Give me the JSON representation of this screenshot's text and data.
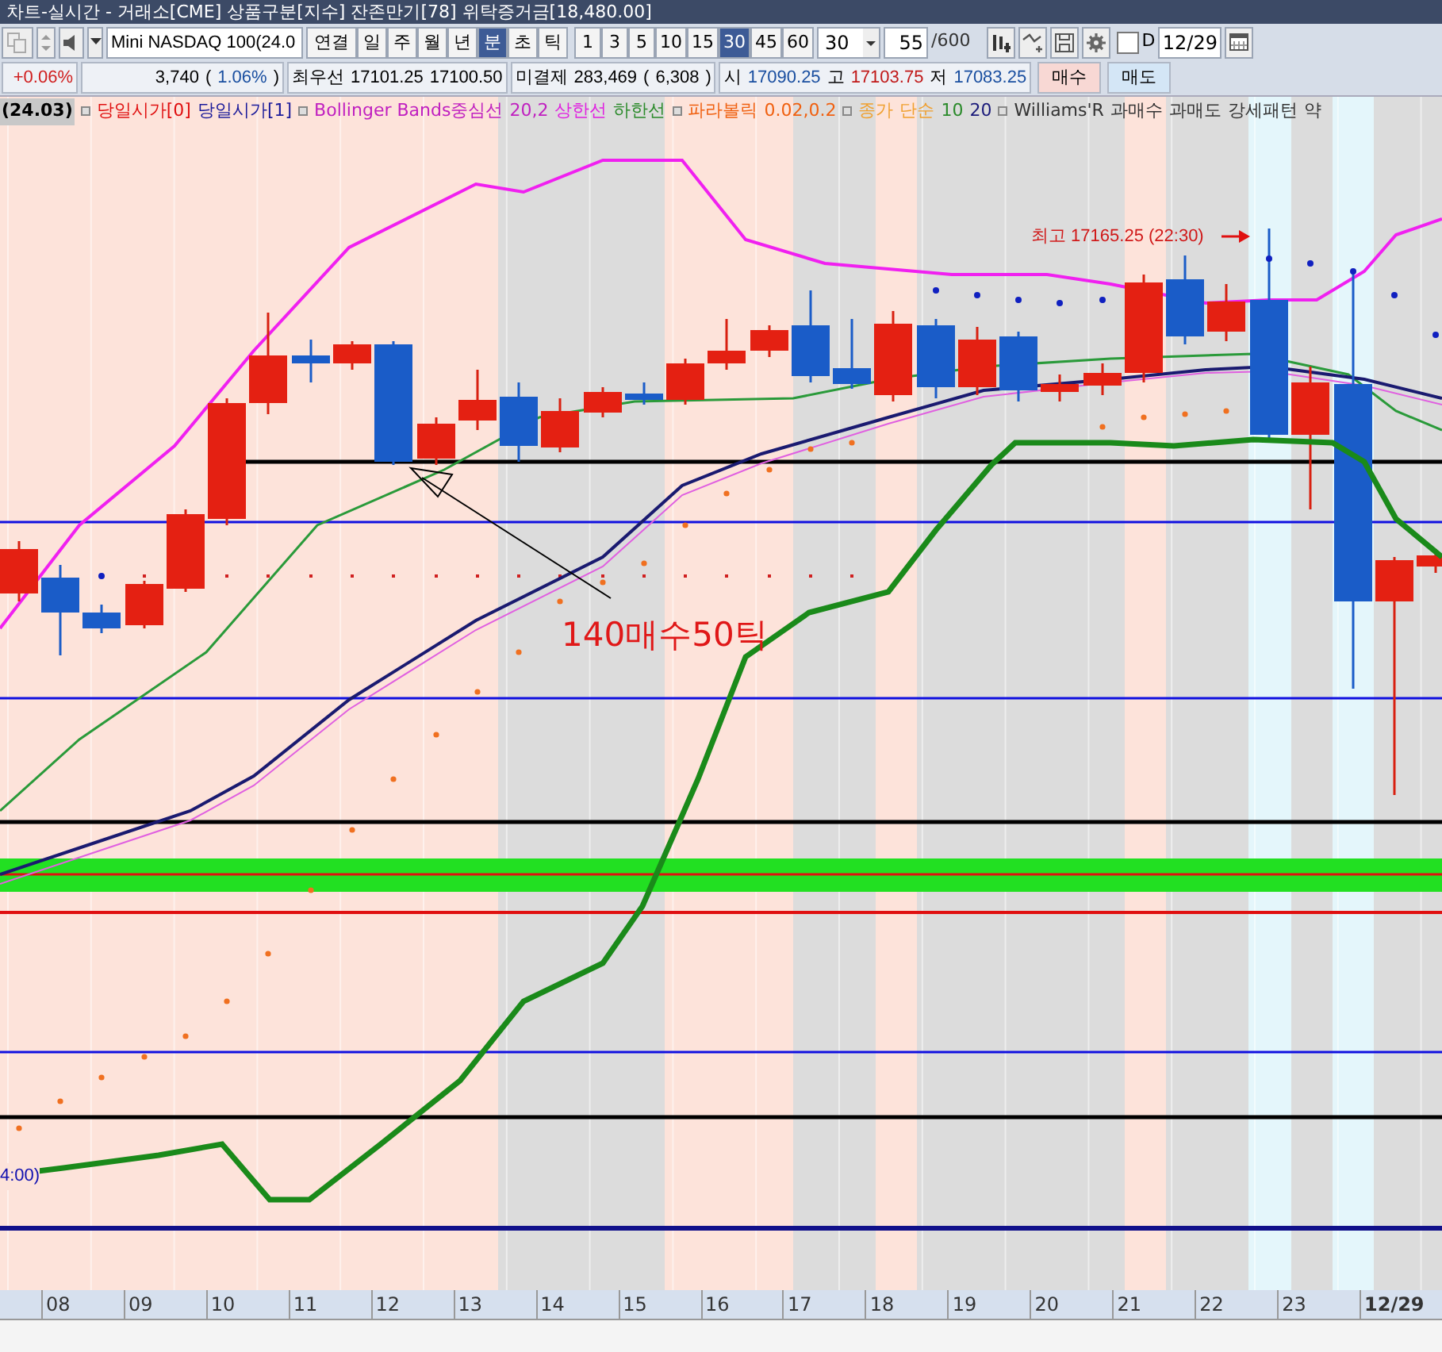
{
  "title": "차트-실시간 - 거래소[CME] 상품구분[지수] 잔존만기[78] 위탁증거금[18,480.00]",
  "toolbar": {
    "symbol": "Mini NASDAQ 100(24.0",
    "modes": [
      {
        "label": "연결",
        "selected": false
      },
      {
        "label": "일",
        "selected": false
      },
      {
        "label": "주",
        "selected": false
      },
      {
        "label": "월",
        "selected": false
      },
      {
        "label": "년",
        "selected": false
      },
      {
        "label": "분",
        "selected": true
      },
      {
        "label": "초",
        "selected": false
      },
      {
        "label": "틱",
        "selected": false
      }
    ],
    "intervals": [
      {
        "label": "1",
        "selected": false
      },
      {
        "label": "3",
        "selected": false
      },
      {
        "label": "5",
        "selected": false
      },
      {
        "label": "10",
        "selected": false
      },
      {
        "label": "15",
        "selected": false
      },
      {
        "label": "30",
        "selected": true
      },
      {
        "label": "45",
        "selected": false
      },
      {
        "label": "60",
        "selected": false
      }
    ],
    "interval_combo": "30",
    "count": "55",
    "count_max": "/600",
    "date_checkbox": {
      "label": "D",
      "checked": false
    },
    "date": "12/29"
  },
  "quote_groups": [
    [
      {
        "text": "+0.06%",
        "color": "#d02020"
      }
    ],
    [
      {
        "text": "3,740",
        "color": "#000000"
      },
      {
        "text": "(",
        "color": "#000000"
      },
      {
        "text": "1.06%",
        "color": "#1a4fa0"
      },
      {
        "text": ")",
        "color": "#000000"
      }
    ],
    [
      {
        "text": "최우선",
        "color": "#000000"
      },
      {
        "text": "17101.25",
        "color": "#000000"
      },
      {
        "text": "17100.50",
        "color": "#000000"
      }
    ],
    [
      {
        "text": "미결제",
        "color": "#000000"
      },
      {
        "text": "283,469",
        "color": "#000000"
      },
      {
        "text": "(",
        "color": "#000000"
      },
      {
        "text": "6,308",
        "color": "#000000"
      },
      {
        "text": ")",
        "color": "#000000"
      }
    ],
    [
      {
        "text": "시",
        "color": "#000000"
      },
      {
        "text": "17090.25",
        "color": "#1a4fa0"
      },
      {
        "text": "고",
        "color": "#000000"
      },
      {
        "text": "17103.75",
        "color": "#c01818"
      },
      {
        "text": "저",
        "color": "#000000"
      },
      {
        "text": "17083.25",
        "color": "#1a4fa0"
      }
    ]
  ],
  "order_buttons": [
    {
      "label": "매수",
      "kind": "buy"
    },
    {
      "label": "매도",
      "kind": "sell"
    }
  ],
  "legend": [
    {
      "text": "(24.03)",
      "color": "#000000",
      "marker": false
    },
    {
      "text": "당일시가[0]",
      "color": "#e01010",
      "marker": true
    },
    {
      "text": "당일시가[1]",
      "color": "#1a1a9a",
      "marker": false
    },
    {
      "text": "Bollinger Bands중심선",
      "color": "#c020c0",
      "marker": true
    },
    {
      "text": "20,2",
      "color": "#c020c0",
      "marker": false
    },
    {
      "text": "상한선",
      "color": "#e020e0",
      "marker": false
    },
    {
      "text": "하한선",
      "color": "#2a8a2a",
      "marker": false
    },
    {
      "text": "파라볼릭",
      "color": "#f06010",
      "marker": true
    },
    {
      "text": "0.02,0.2",
      "color": "#f06010",
      "marker": false
    },
    {
      "text": "종가",
      "color": "#f0a030",
      "marker": true
    },
    {
      "text": "단순",
      "color": "#f0a030",
      "marker": false
    },
    {
      "text": "10",
      "color": "#2a8a2a",
      "marker": false
    },
    {
      "text": "20",
      "color": "#1a1a7a",
      "marker": false
    },
    {
      "text": "Williams'R",
      "color": "#333333",
      "marker": true
    },
    {
      "text": "과매수",
      "color": "#333333",
      "marker": false
    },
    {
      "text": "과매도",
      "color": "#333333",
      "marker": false
    },
    {
      "text": "강세패턴",
      "color": "#333333",
      "marker": false
    },
    {
      "text": "약",
      "color": "#333333",
      "marker": false
    }
  ],
  "annotations": [
    {
      "text": "140매수50틱",
      "kind": "callout"
    },
    {
      "text": "최고 17165.25 (22:30)",
      "kind": "high"
    },
    {
      "text": "4:00)",
      "kind": "edge"
    }
  ],
  "x_axis": [
    {
      "text": "08",
      "current": false
    },
    {
      "text": "09",
      "current": false
    },
    {
      "text": "10",
      "current": false
    },
    {
      "text": "11",
      "current": false
    },
    {
      "text": "12",
      "current": false
    },
    {
      "text": "13",
      "current": false
    },
    {
      "text": "14",
      "current": false
    },
    {
      "text": "15",
      "current": false
    },
    {
      "text": "16",
      "current": false
    },
    {
      "text": "17",
      "current": false
    },
    {
      "text": "18",
      "current": false
    },
    {
      "text": "19",
      "current": false
    },
    {
      "text": "20",
      "current": false
    },
    {
      "text": "21",
      "current": false
    },
    {
      "text": "22",
      "current": false
    },
    {
      "text": "23",
      "current": false
    },
    {
      "text": "12/29",
      "current": true
    }
  ]
}
